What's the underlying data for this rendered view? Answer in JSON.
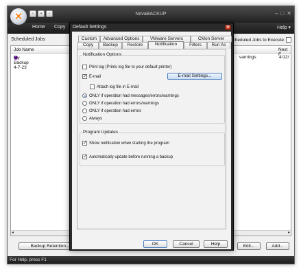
{
  "app": {
    "title": "NovaBACKUP",
    "ribbon_tabs": [
      "Home",
      "Copy"
    ],
    "help_label": "Help",
    "help_arrow": "▾",
    "window_controls": {
      "minimize": "–",
      "restore": "□",
      "close": "✕"
    },
    "scheduled_jobs_label": "Scheduled Jobs",
    "show_scheduled_label": "w Scheduled Jobs to Execute",
    "grid": {
      "columns": [
        "Job Name",
        "Next F"
      ],
      "rows": [
        {
          "job_name": "My Backup 4-7-23",
          "partial_text": "varnings",
          "next_run": "4/12/"
        }
      ]
    },
    "buttons": {
      "backup_retention": "Backup Retention...",
      "edit": "Edit...",
      "add": "Add..."
    },
    "status_text": "For Help, press F1",
    "scroll_left": "◂",
    "scroll_right": "▸"
  },
  "dialog": {
    "title": "Default Settings",
    "close_glyph": "✕",
    "tabs_row1": [
      "Custom",
      "Advanced Options",
      "VMware Servers",
      "CMon Server"
    ],
    "tabs_row2": [
      "Copy",
      "Backup",
      "Restore",
      "Notification",
      "Filters",
      "Run As"
    ],
    "active_tab": "Notification",
    "notification_options": {
      "title": "Notification Options",
      "print_log_label": "Print log (Prints log file to your default printer)",
      "print_log_checked": false,
      "email_label": "E-mail",
      "email_checked": true,
      "email_settings_button": "E-mail Settings...",
      "attach_log_label": "Attach log file in E-mail",
      "attach_log_checked": false,
      "radios": [
        {
          "label": "ONLY if operation had messages/errors/warnings",
          "selected": true
        },
        {
          "label": "ONLY if operation had errors/warnings",
          "selected": false
        },
        {
          "label": "ONLY if operation had errors",
          "selected": false
        },
        {
          "label": "Always",
          "selected": false
        }
      ]
    },
    "program_updates": {
      "title": "Program Updates",
      "show_notification_label": "Show notification when starting the program",
      "show_notification_checked": true,
      "auto_update_label": "Automatically update before running a backup",
      "auto_update_checked": true
    },
    "buttons": {
      "ok": "OK",
      "cancel": "Cancel",
      "help": "Help"
    },
    "check_glyph": "✓"
  }
}
